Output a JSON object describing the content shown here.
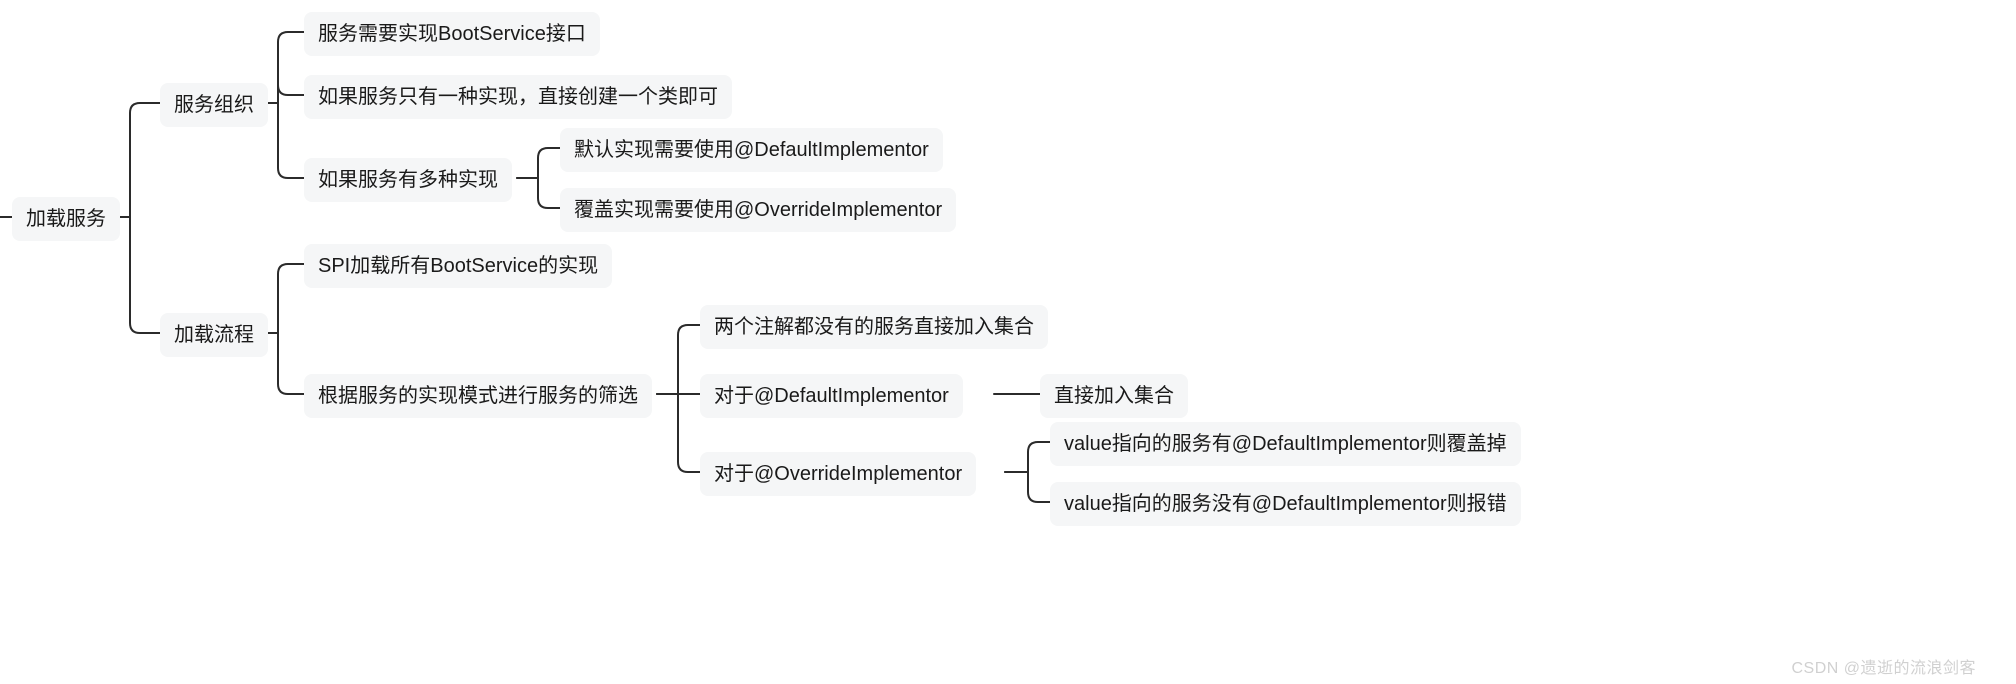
{
  "root": {
    "label": "加载服务"
  },
  "branch1": {
    "label": "服务组织",
    "children": {
      "c1": "服务需要实现BootService接口",
      "c2": "如果服务只有一种实现，直接创建一个类即可",
      "c3": {
        "label": "如果服务有多种实现",
        "children": {
          "d1": "默认实现需要使用@DefaultImplementor",
          "d2": "覆盖实现需要使用@OverrideImplementor"
        }
      }
    }
  },
  "branch2": {
    "label": "加载流程",
    "children": {
      "c1": "SPI加载所有BootService的实现",
      "c2": {
        "label": "根据服务的实现模式进行服务的筛选",
        "children": {
          "d1": "两个注解都没有的服务直接加入集合",
          "d2": {
            "label": "对于@DefaultImplementor",
            "child": "直接加入集合"
          },
          "d3": {
            "label": "对于@OverrideImplementor",
            "children": {
              "e1": "value指向的服务有@DefaultImplementor则覆盖掉",
              "e2": "value指向的服务没有@DefaultImplementor则报错"
            }
          }
        }
      }
    }
  },
  "watermark": "CSDN @遗逝的流浪剑客"
}
